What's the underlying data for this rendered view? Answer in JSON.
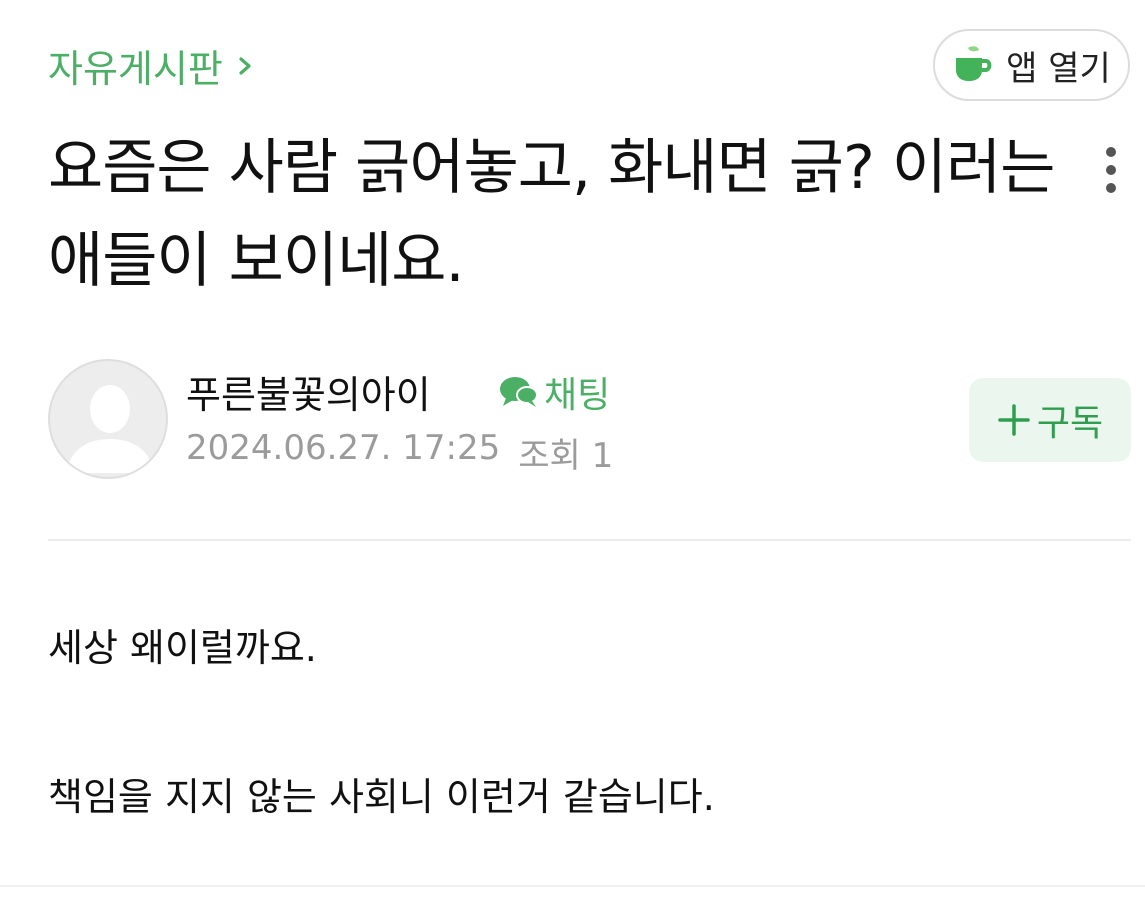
{
  "header": {
    "board_name": "자유게시판",
    "open_app_label": "앱 열기"
  },
  "post": {
    "title": "요즘은 사람 긁어놓고, 화내면 긁? 이러는 애들이 보이네요.",
    "author": "푸른불꽃의아이",
    "chat_label": "채팅",
    "date": "2024.06.27. 17:25",
    "views": "조회 1",
    "subscribe_label": "구독",
    "body": [
      "세상 왜이럴까요.",
      "책임을 지지 않는 사회니 이런거 같습니다."
    ]
  },
  "icons": [
    "chevron-right-icon",
    "cup-icon",
    "more-vertical-icon",
    "avatar-silhouette",
    "chat-bubble-icon",
    "plus-icon"
  ],
  "colors": {
    "accent_green": "#4caf66",
    "subscribe_bg": "#ebf7ee",
    "meta_gray": "#9b9b9b"
  }
}
